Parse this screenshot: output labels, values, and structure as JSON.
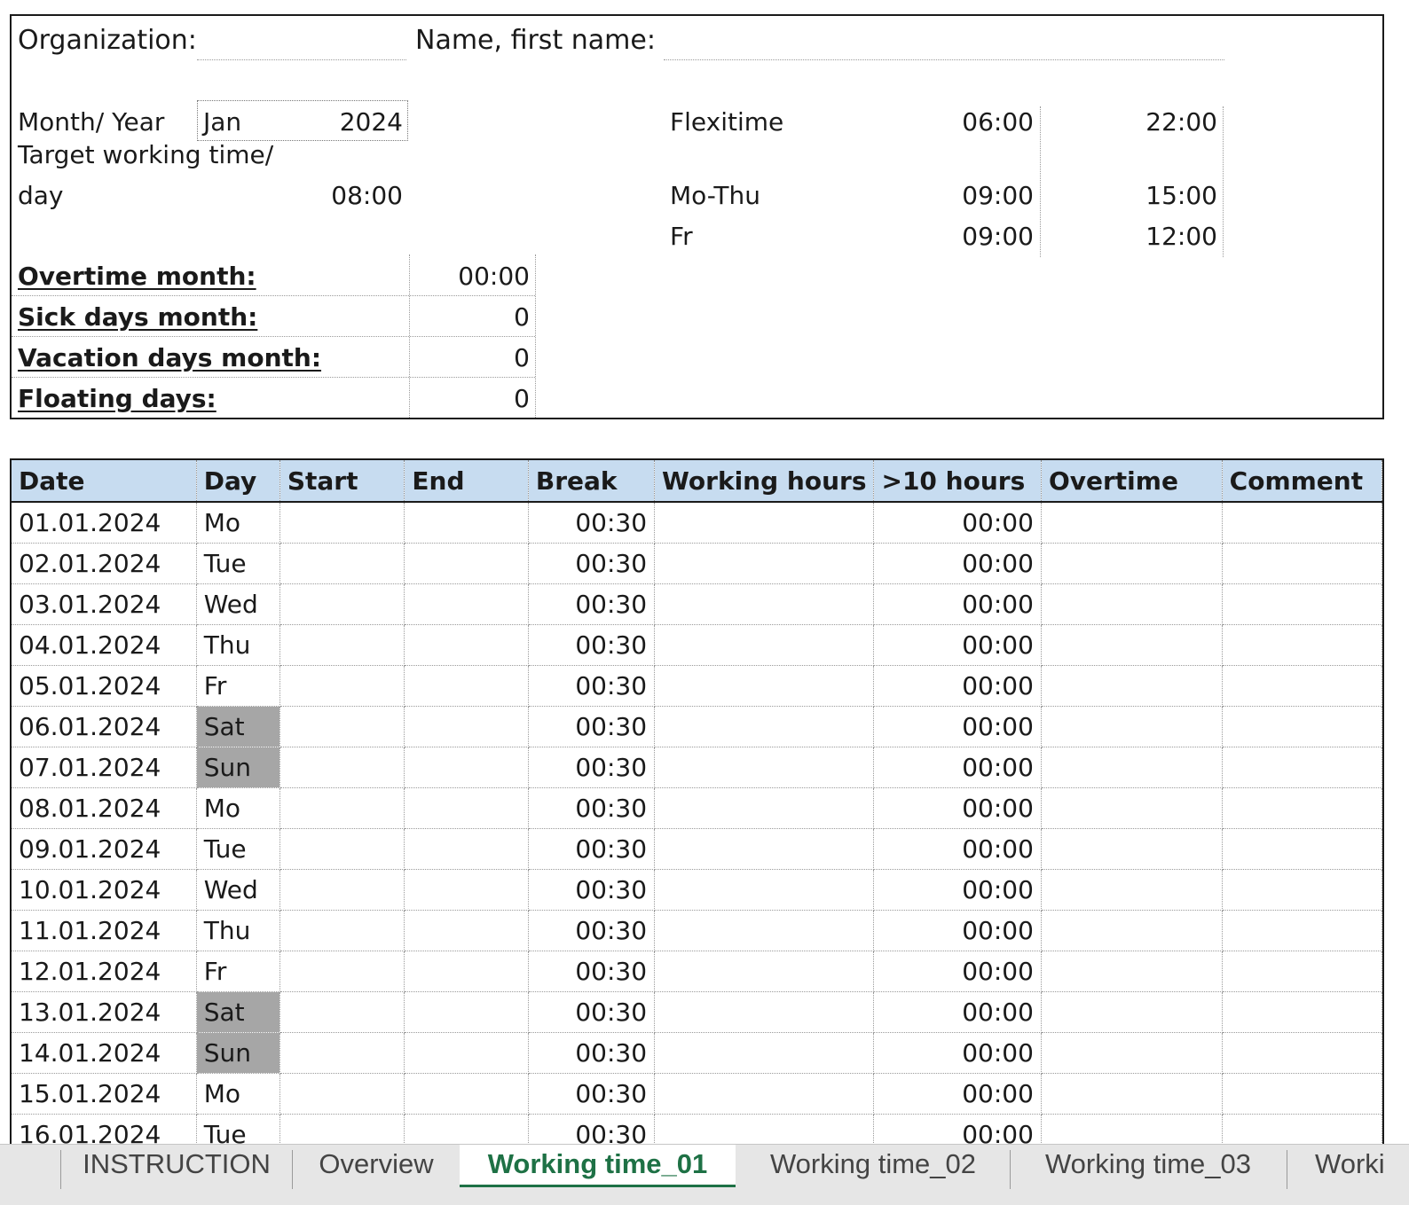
{
  "header": {
    "organization_label": "Organization:",
    "name_label": "Name, first name:",
    "month_year_label": "Month/ Year",
    "month_value": "Jan",
    "year_value": "2024",
    "target_label_line1": "Target working time/",
    "target_label_line2": "day",
    "target_value": "08:00",
    "flexitime_label": "Flexitime",
    "flexitime_start": "06:00",
    "flexitime_end": "22:00",
    "mothu_label": "Mo-Thu",
    "mothu_start": "09:00",
    "mothu_end": "15:00",
    "fr_label": "Fr",
    "fr_start": "09:00",
    "fr_end": "12:00",
    "overtime_month_label": "Overtime month:",
    "overtime_month_value": "00:00",
    "sick_days_label": "Sick days month:",
    "sick_days_value": "0",
    "vacation_days_label": "Vacation days month:",
    "vacation_days_value": "0",
    "floating_days_label": "Floating days:",
    "floating_days_value": "0"
  },
  "table": {
    "columns": [
      "Date",
      "Day",
      "Start",
      "End",
      "Break",
      "Working hours",
      ">10 hours",
      "Overtime",
      "Comment"
    ],
    "rows": [
      {
        "date": "01.01.2024",
        "day": "Mo",
        "break": "00:30",
        "over10": "00:00",
        "weekend": false
      },
      {
        "date": "02.01.2024",
        "day": "Tue",
        "break": "00:30",
        "over10": "00:00",
        "weekend": false
      },
      {
        "date": "03.01.2024",
        "day": "Wed",
        "break": "00:30",
        "over10": "00:00",
        "weekend": false
      },
      {
        "date": "04.01.2024",
        "day": "Thu",
        "break": "00:30",
        "over10": "00:00",
        "weekend": false
      },
      {
        "date": "05.01.2024",
        "day": "Fr",
        "break": "00:30",
        "over10": "00:00",
        "weekend": false
      },
      {
        "date": "06.01.2024",
        "day": "Sat",
        "break": "00:30",
        "over10": "00:00",
        "weekend": true
      },
      {
        "date": "07.01.2024",
        "day": "Sun",
        "break": "00:30",
        "over10": "00:00",
        "weekend": true
      },
      {
        "date": "08.01.2024",
        "day": "Mo",
        "break": "00:30",
        "over10": "00:00",
        "weekend": false
      },
      {
        "date": "09.01.2024",
        "day": "Tue",
        "break": "00:30",
        "over10": "00:00",
        "weekend": false
      },
      {
        "date": "10.01.2024",
        "day": "Wed",
        "break": "00:30",
        "over10": "00:00",
        "weekend": false
      },
      {
        "date": "11.01.2024",
        "day": "Thu",
        "break": "00:30",
        "over10": "00:00",
        "weekend": false
      },
      {
        "date": "12.01.2024",
        "day": "Fr",
        "break": "00:30",
        "over10": "00:00",
        "weekend": false
      },
      {
        "date": "13.01.2024",
        "day": "Sat",
        "break": "00:30",
        "over10": "00:00",
        "weekend": true
      },
      {
        "date": "14.01.2024",
        "day": "Sun",
        "break": "00:30",
        "over10": "00:00",
        "weekend": true
      },
      {
        "date": "15.01.2024",
        "day": "Mo",
        "break": "00:30",
        "over10": "00:00",
        "weekend": false
      },
      {
        "date": "16.01.2024",
        "day": "Tue",
        "break": "00:30",
        "over10": "00:00",
        "weekend": false
      }
    ]
  },
  "tabs": [
    {
      "label": "INSTRUCTION",
      "active": false
    },
    {
      "label": "Overview",
      "active": false
    },
    {
      "label": "Working time_01",
      "active": true
    },
    {
      "label": "Working time_02",
      "active": false
    },
    {
      "label": "Working time_03",
      "active": false
    },
    {
      "label": "Worki",
      "active": false
    }
  ],
  "colors": {
    "header_fill": "#c7dcf0",
    "weekend_fill": "#a6a6a6",
    "active_tab": "#1e7145"
  }
}
